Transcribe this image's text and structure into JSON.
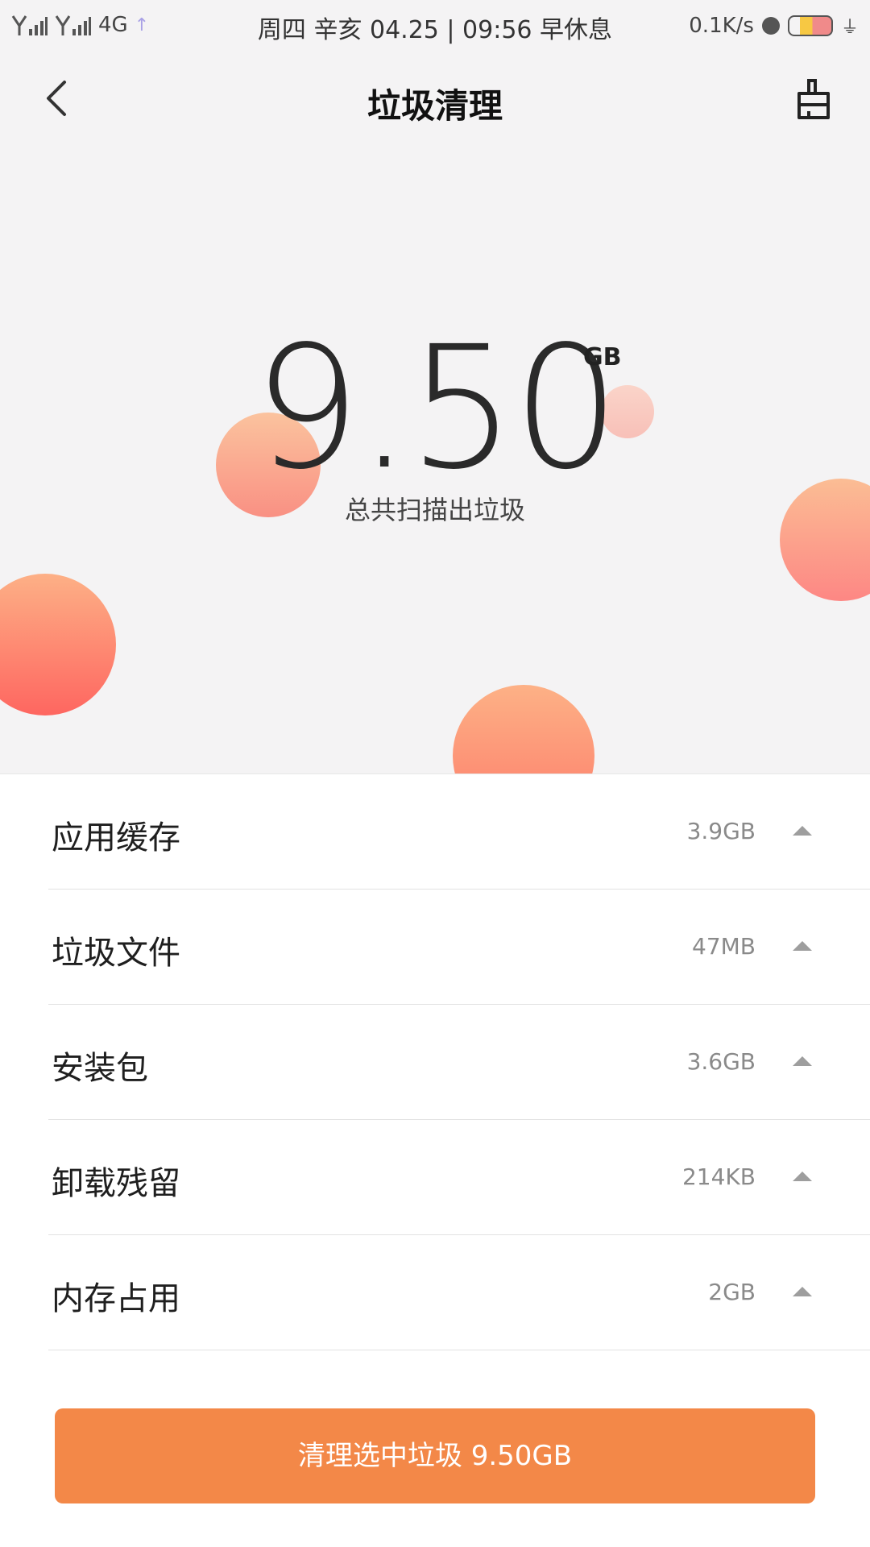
{
  "status_bar": {
    "network": "4G",
    "date_time": "周四  辛亥 04.25 | 09:56 早休息",
    "speed": "0.1K/s"
  },
  "header": {
    "title": "垃圾清理"
  },
  "hero": {
    "total_value": "9.50",
    "total_unit": "GB",
    "subtitle": "总共扫描出垃圾"
  },
  "categories": [
    {
      "label": "应用缓存",
      "size": "3.9GB"
    },
    {
      "label": "垃圾文件",
      "size": "47MB"
    },
    {
      "label": "安装包",
      "size": "3.6GB"
    },
    {
      "label": "卸载残留",
      "size": "214KB"
    },
    {
      "label": "内存占用",
      "size": "2GB"
    }
  ],
  "clean_button": {
    "label": "清理选中垃圾 9.50GB"
  },
  "colors": {
    "accent": "#f38848",
    "bubble_start": "#fbbd94",
    "bubble_end": "#fd7c6a"
  }
}
